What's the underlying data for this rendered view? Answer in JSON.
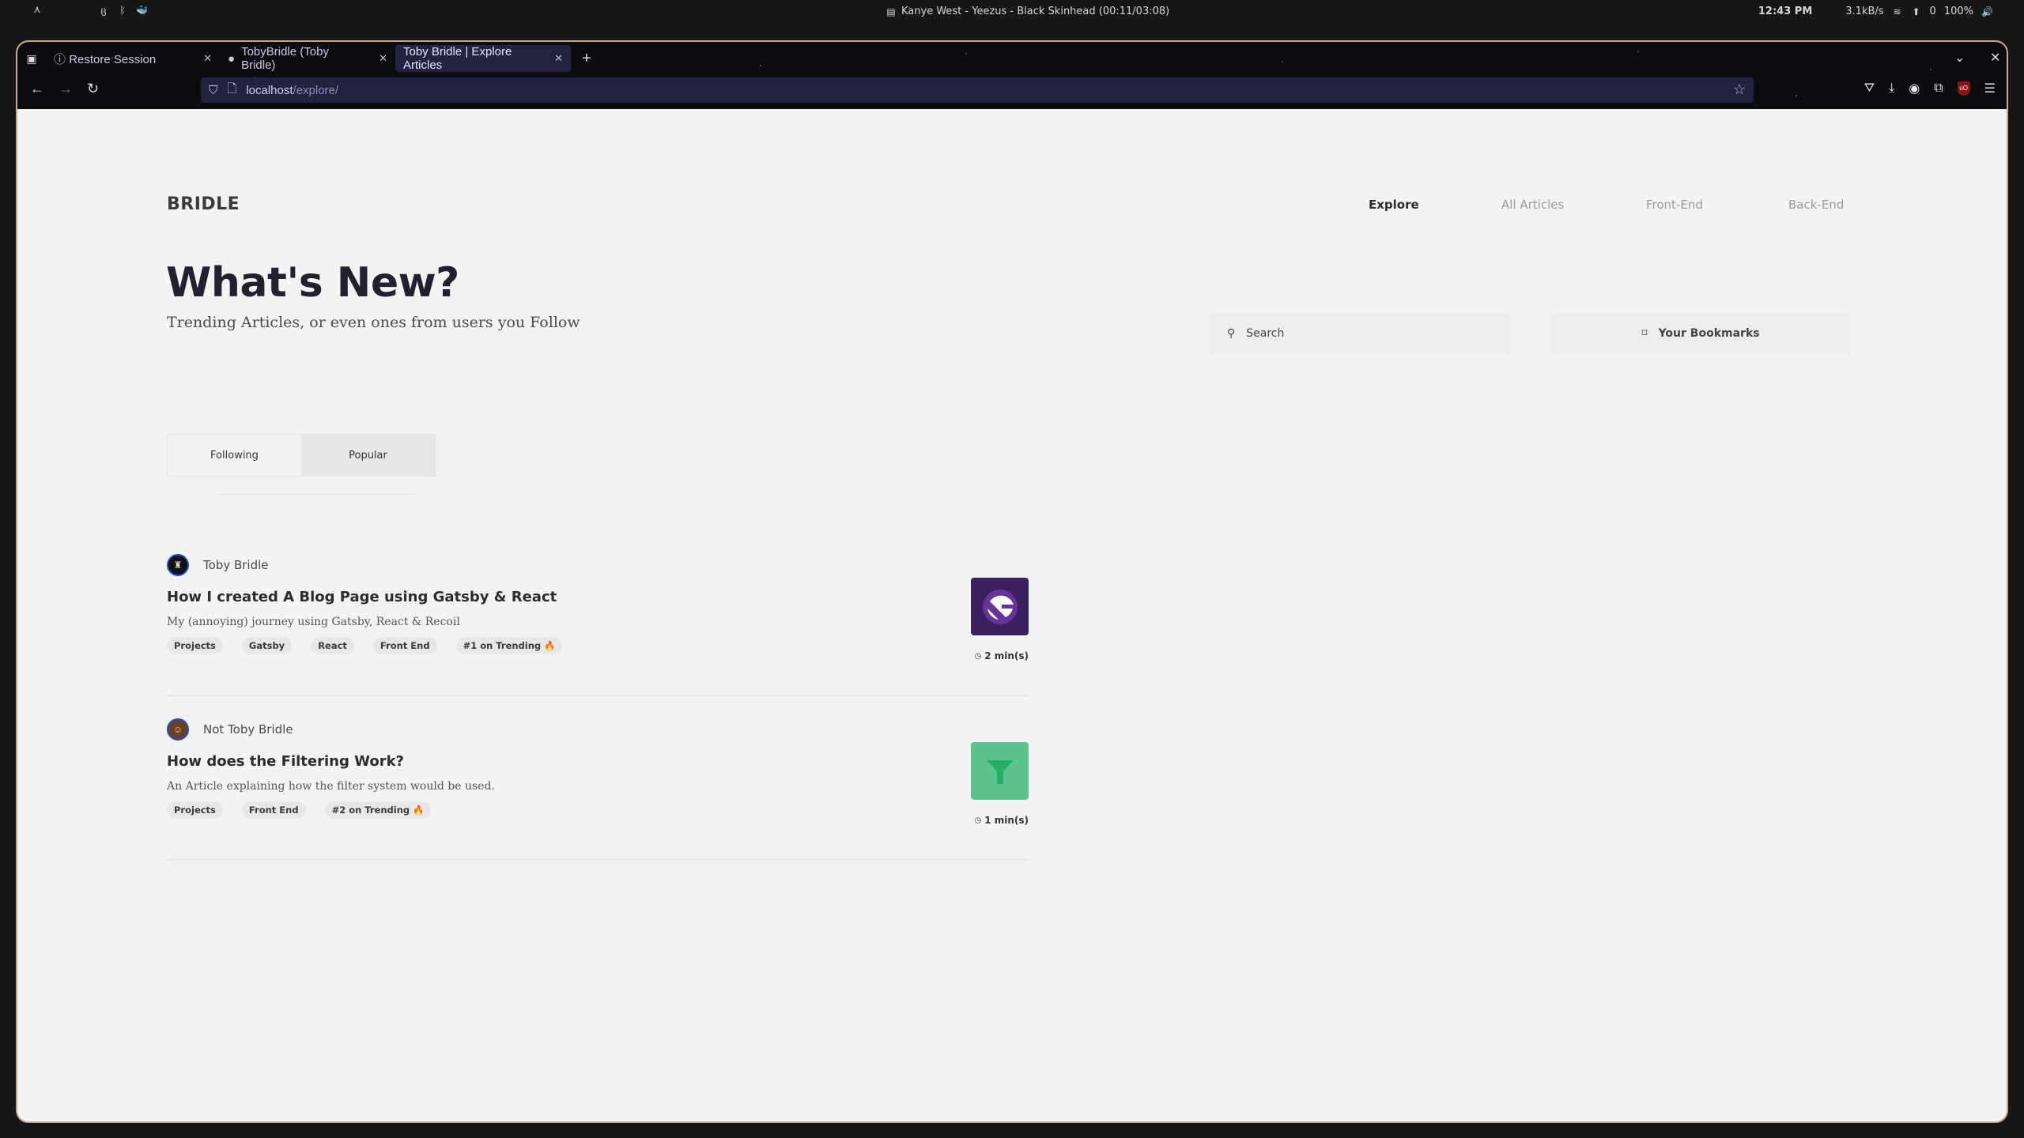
{
  "system_bar": {
    "launcher_icon": "arch-launcher-icon",
    "tray_icons": [
      "system-tray-icon",
      "bluetooth-icon",
      "docker-icon"
    ],
    "now_playing": "Kanye West - Yeezus - Black Skinhead (00:11/03:08)",
    "clock": "12:43 PM",
    "network_speed": "3.1kB/s",
    "updates_count": "0",
    "volume": "100%"
  },
  "browser": {
    "tabs": [
      {
        "label": "Restore Session",
        "icon": "info-icon",
        "active": false
      },
      {
        "label": "TobyBridle (Toby Bridle)",
        "icon": "github-icon",
        "active": false
      },
      {
        "label": "Toby Bridle | Explore Articles",
        "icon": "",
        "active": true
      }
    ],
    "url_host": "localhost",
    "url_path": "/explore/"
  },
  "site": {
    "brand": "BRIDLE",
    "nav": [
      {
        "label": "Explore",
        "active": true
      },
      {
        "label": "All Articles",
        "active": false
      },
      {
        "label": "Front-End",
        "active": false
      },
      {
        "label": "Back-End",
        "active": false
      }
    ],
    "headline": "What's New?",
    "subheadline": "Trending Articles, or even ones from users you Follow",
    "search_placeholder": "Search",
    "bookmarks_label": "Your Bookmarks",
    "feed_toggle": [
      {
        "label": "Following",
        "selected": false
      },
      {
        "label": "Popular",
        "selected": true
      }
    ],
    "articles": [
      {
        "author": "Toby Bridle",
        "title": "How I created A Blog Page using Gatsby & React",
        "description": "My (annoying) journey using Gatsby, React & Recoil",
        "tags": [
          "Projects",
          "Gatsby",
          "React",
          "Front End",
          "#1 on Trending 🔥"
        ],
        "thumbnail": "gatsby-logo",
        "thumbnail_color": "#3b1f5e",
        "read_time": "2 min(s)"
      },
      {
        "author": "Not Toby Bridle",
        "title": "How does the Filtering Work?",
        "description": "An Article explaining how the filter system would be used.",
        "tags": [
          "Projects",
          "Front End",
          "#2 on Trending 🔥"
        ],
        "thumbnail": "filter-funnel",
        "thumbnail_color": "#5ec28e",
        "read_time": "1 min(s)"
      }
    ]
  }
}
